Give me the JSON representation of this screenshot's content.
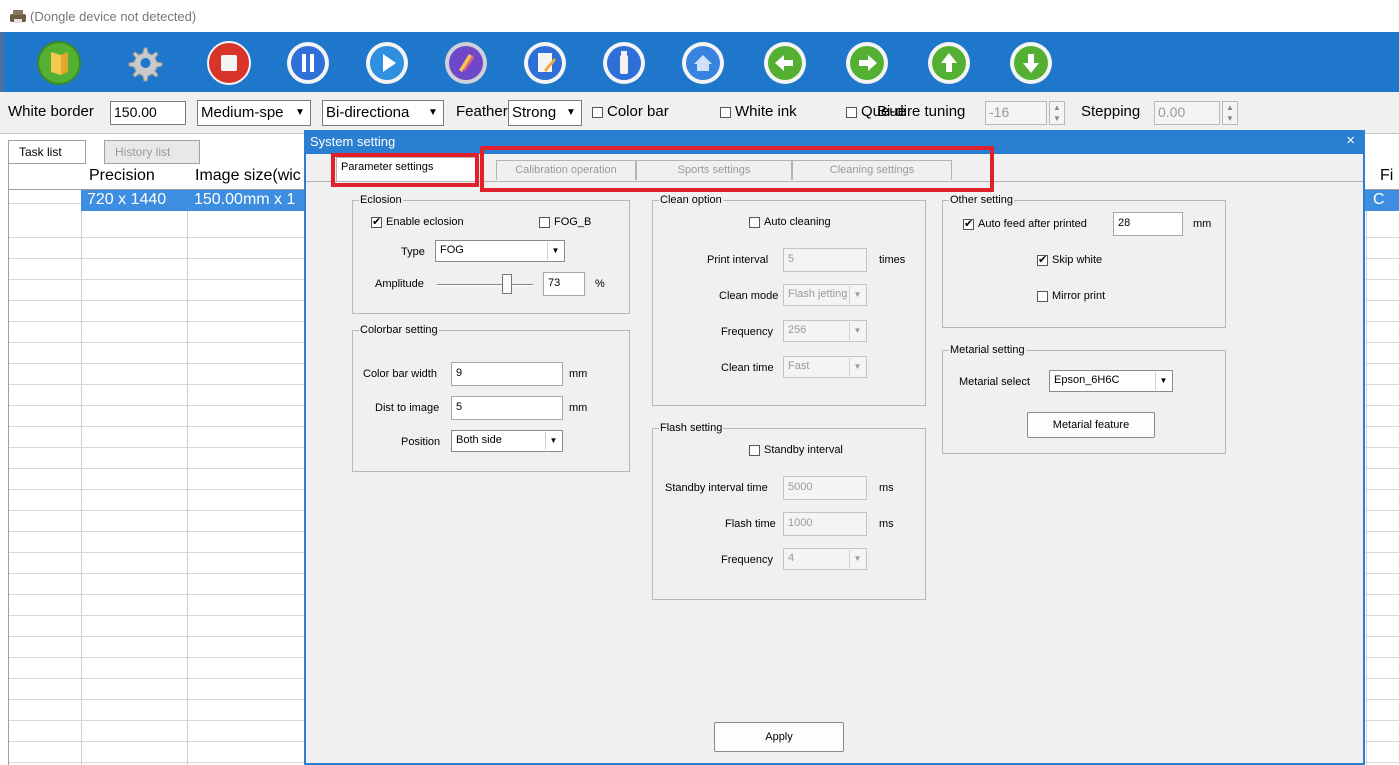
{
  "app": {
    "title": "(Dongle device not detected)"
  },
  "toolbar": {
    "colors": {
      "bar": "#1f77cc",
      "green": "#54b032",
      "red": "#d9342a",
      "blue": "#2f6fd8",
      "purple": "#6e48c8"
    },
    "buttons": [
      {
        "name": "open-file-button",
        "icon": "book-icon"
      },
      {
        "name": "settings-button",
        "icon": "gear-icon"
      },
      {
        "name": "stop-button",
        "icon": "stop-icon"
      },
      {
        "name": "pause-button",
        "icon": "pause-icon"
      },
      {
        "name": "play-button",
        "icon": "play-icon"
      },
      {
        "name": "color-button",
        "icon": "palette-icon"
      },
      {
        "name": "edit-button",
        "icon": "edit-icon"
      },
      {
        "name": "ink-button",
        "icon": "ink-bottle-icon"
      },
      {
        "name": "home-button",
        "icon": "home-icon"
      },
      {
        "name": "move-left-button",
        "icon": "arrow-left-icon"
      },
      {
        "name": "move-right-button",
        "icon": "arrow-right-icon"
      },
      {
        "name": "move-up-button",
        "icon": "arrow-up-icon"
      },
      {
        "name": "move-down-button",
        "icon": "arrow-down-icon"
      }
    ]
  },
  "options": {
    "white_border_label": "White border",
    "white_border_value": "150.00",
    "speed_value": "Medium-spe",
    "direction_value": "Bi-directiona",
    "feather_label": "Feather",
    "feather_value": "Strong",
    "color_bar_label": "Color bar",
    "white_ink_label": "White ink",
    "queue_label": "Queue",
    "bidir_tuning_label": "Bi-dire tuning",
    "bidir_tuning_value": "-16",
    "stepping_label": "Stepping",
    "stepping_value": "0.00"
  },
  "main": {
    "tabs": [
      {
        "label": "Task list",
        "active": true
      },
      {
        "label": "History list",
        "active": false
      }
    ],
    "columns": [
      "Precision",
      "Image size(wic",
      "Fi"
    ],
    "selected_row": {
      "precision": "720 x 1440",
      "image_size": "150.00mm x 1",
      "last": "C"
    }
  },
  "dialog": {
    "title": "System setting",
    "close_glyph": "×",
    "tabs": [
      {
        "label": "Parameter settings",
        "active": true
      },
      {
        "label": "Calibration operation",
        "active": false
      },
      {
        "label": "Sports settings",
        "active": false
      },
      {
        "label": "Cleaning settings",
        "active": false
      }
    ],
    "highlight_color": "#e0202a",
    "eclosion": {
      "legend": "Eclosion",
      "enable_label": "Enable eclosion",
      "enable_checked": true,
      "fog_b_label": "FOG_B",
      "fog_b_checked": false,
      "type_label": "Type",
      "type_value": "FOG",
      "amplitude_label": "Amplitude",
      "amplitude_value": "73",
      "amplitude_unit": "%",
      "amplitude_level": 0.73
    },
    "colorbar": {
      "legend": "Colorbar setting",
      "width_label": "Color bar width",
      "width_value": "9",
      "width_unit": "mm",
      "dist_label": "Dist to image",
      "dist_value": "5",
      "dist_unit": "mm",
      "position_label": "Position",
      "position_value": "Both side"
    },
    "clean": {
      "legend": "Clean option",
      "auto_label": "Auto cleaning",
      "auto_checked": false,
      "interval_label": "Print interval",
      "interval_value": "5",
      "interval_unit": "times",
      "mode_label": "Clean mode",
      "mode_value": "Flash jetting",
      "freq_label": "Frequency",
      "freq_value": "256",
      "time_label": "Clean time",
      "time_value": "Fast"
    },
    "flash": {
      "legend": "Flash setting",
      "standby_label": "Standby interval",
      "standby_checked": false,
      "standby_time_label": "Standby interval time",
      "standby_time_value": "5000",
      "standby_time_unit": "ms",
      "flash_time_label": "Flash time",
      "flash_time_value": "1000",
      "flash_time_unit": "ms",
      "freq_label": "Frequency",
      "freq_value": "4"
    },
    "other": {
      "legend": "Other setting",
      "auto_feed_label": "Auto feed after printed",
      "auto_feed_checked": true,
      "auto_feed_value": "28",
      "auto_feed_unit": "mm",
      "skip_white_label": "Skip white",
      "skip_white_checked": true,
      "mirror_label": "Mirror print",
      "mirror_checked": false
    },
    "material": {
      "legend": "Metarial setting",
      "select_label": "Metarial select",
      "select_value": "Epson_6H6C",
      "feature_button": "Metarial feature"
    },
    "apply_button": "Apply"
  }
}
